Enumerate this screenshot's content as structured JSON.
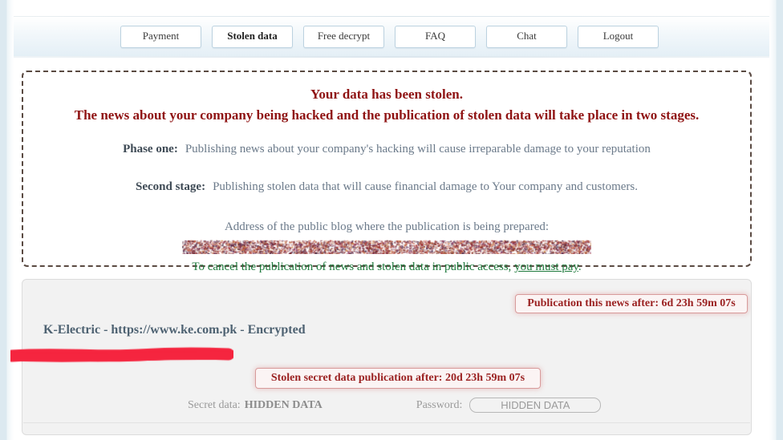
{
  "nav": {
    "items": [
      {
        "label": "Payment",
        "active": false
      },
      {
        "label": "Stolen data",
        "active": true
      },
      {
        "label": "Free decrypt",
        "active": false
      },
      {
        "label": "FAQ",
        "active": false
      },
      {
        "label": "Chat",
        "active": false
      },
      {
        "label": "Logout",
        "active": false
      }
    ]
  },
  "notice": {
    "headline1": "Your data has been stolen.",
    "headline2": "The news about your company being hacked and the publication of stolen data will take place in two stages.",
    "phase_one_label": "Phase one:",
    "phase_one_text": "Publishing news about your company's hacking will cause irreparable damage to your reputation",
    "phase_two_label": "Second stage:",
    "phase_two_text": "Publishing stolen data that will cause financial damage to Your company and customers.",
    "blog_label": "Address of the public blog where the publication is being prepared:",
    "blog_url_redacted": "",
    "cancel_text_before": "To cancel the publication of news and stolen data in public access, ",
    "cancel_link": "you must pay",
    "cancel_text_after": "."
  },
  "victim": {
    "news_countdown": "Publication this news after: 6d 23h 59m 07s",
    "title": "K-Electric - https://www.ke.com.pk - Encrypted",
    "data_countdown": "Stolen secret data publication after: 20d 23h 59m 07s",
    "secret_label": "Secret data:",
    "secret_value": "HIDDEN DATA",
    "password_label": "Password:",
    "password_value": "HIDDEN DATA"
  },
  "annotation": {
    "redaction_color": "#f5253f"
  },
  "colors": {
    "headline_red": "#8f1313",
    "body_slate": "#6b7a8a",
    "label_slate": "#3e4a55",
    "green": "#1f7a3d",
    "countdown_red": "#9b2222",
    "victim_title": "#4e6272",
    "panel_bg": "#f2f2f2"
  }
}
